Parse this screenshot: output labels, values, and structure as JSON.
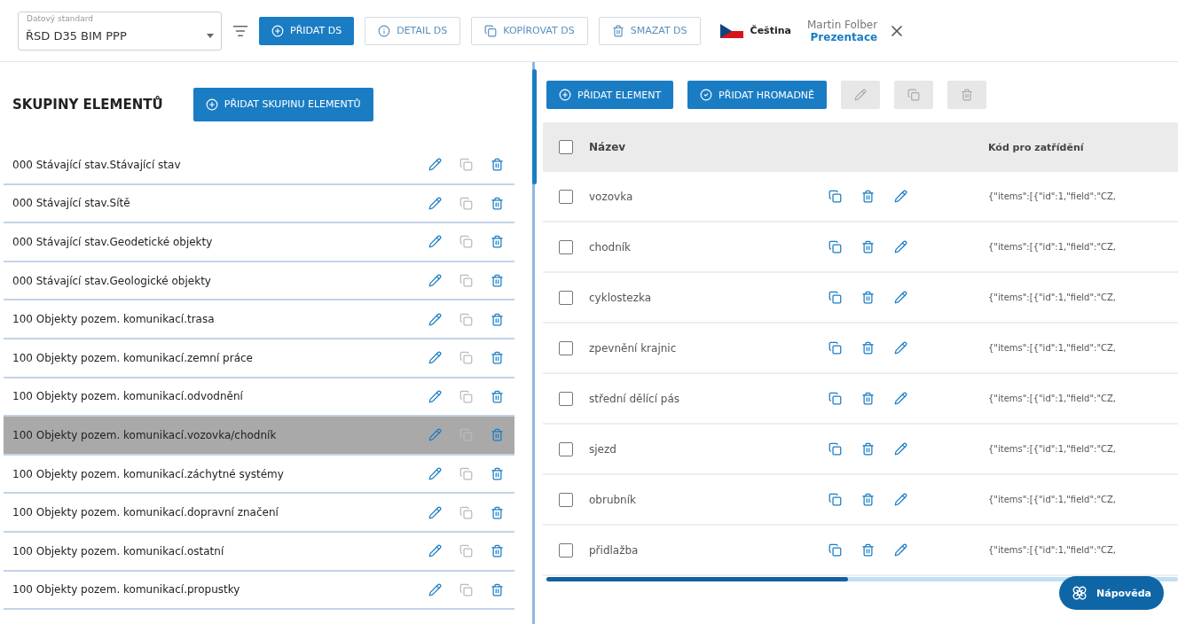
{
  "header": {
    "standard_field": {
      "label": "Datový standard",
      "value": "ŘSD D35 BIM PPP"
    },
    "buttons": [
      {
        "kind": "primary",
        "label": "PŘIDAT DS"
      },
      {
        "kind": "outlined",
        "label": "DETAIL DS"
      },
      {
        "kind": "outlined",
        "label": "KOPÍROVAT DS"
      },
      {
        "kind": "outlined",
        "label": "SMAZAT DS"
      }
    ],
    "language": "Čeština",
    "user": {
      "name": "Martin Folber",
      "role": "Prezentace"
    }
  },
  "groups_panel": {
    "title": "SKUPINY ELEMENTŮ",
    "add_button": "PŘIDAT SKUPINU ELEMENTŮ",
    "items": [
      {
        "label": "000 Stávající stav.Stávající stav",
        "selected": false
      },
      {
        "label": "000 Stávající stav.Sítě",
        "selected": false
      },
      {
        "label": "000 Stávající stav.Geodetické objekty",
        "selected": false
      },
      {
        "label": "000 Stávající stav.Geologické objekty",
        "selected": false
      },
      {
        "label": "100 Objekty pozem. komunikací.trasa",
        "selected": false
      },
      {
        "label": "100 Objekty pozem. komunikací.zemní práce",
        "selected": false
      },
      {
        "label": "100 Objekty pozem. komunikací.odvodnění",
        "selected": false
      },
      {
        "label": "100 Objekty pozem. komunikací.vozovka/chodník",
        "selected": true
      },
      {
        "label": "100 Objekty pozem. komunikací.záchytné systémy",
        "selected": false
      },
      {
        "label": "100 Objekty pozem. komunikací.dopravní značení",
        "selected": false
      },
      {
        "label": "100 Objekty pozem. komunikací.ostatní",
        "selected": false
      },
      {
        "label": "100 Objekty pozem. komunikací.propustky",
        "selected": false
      }
    ]
  },
  "elements_panel": {
    "toolbar": [
      {
        "kind": "primary",
        "label": "PŘIDAT ELEMENT",
        "disabled": false
      },
      {
        "kind": "primary",
        "label": "PŘIDAT HROMADNĚ",
        "disabled": false
      },
      {
        "kind": "icon",
        "disabled": true
      },
      {
        "kind": "icon",
        "disabled": true
      },
      {
        "kind": "icon",
        "disabled": true
      }
    ],
    "table": {
      "columns": [
        "Název",
        "Kód pro zatřídění"
      ],
      "header_checked": false,
      "rows": [
        {
          "name": "vozovka",
          "code": "{\"items\":[{\"id\":1,\"field\":\"CZ,",
          "checked": false
        },
        {
          "name": "chodník",
          "code": "{\"items\":[{\"id\":1,\"field\":\"CZ,",
          "checked": false
        },
        {
          "name": "cyklostezka",
          "code": "{\"items\":[{\"id\":1,\"field\":\"CZ,",
          "checked": false
        },
        {
          "name": "zpevnění krajnic",
          "code": "{\"items\":[{\"id\":1,\"field\":\"CZ,",
          "checked": false
        },
        {
          "name": "střední dělící pás",
          "code": "{\"items\":[{\"id\":1,\"field\":\"CZ,",
          "checked": false
        },
        {
          "name": "sjezd",
          "code": "{\"items\":[{\"id\":1,\"field\":\"CZ,",
          "checked": false
        },
        {
          "name": "obrubník",
          "code": "{\"items\":[{\"id\":1,\"field\":\"CZ,",
          "checked": false
        },
        {
          "name": "přidlažba",
          "code": "{\"items\":[{\"id\":1,\"field\":\"CZ,",
          "checked": false
        }
      ]
    }
  },
  "help_button": "Nápověda"
}
